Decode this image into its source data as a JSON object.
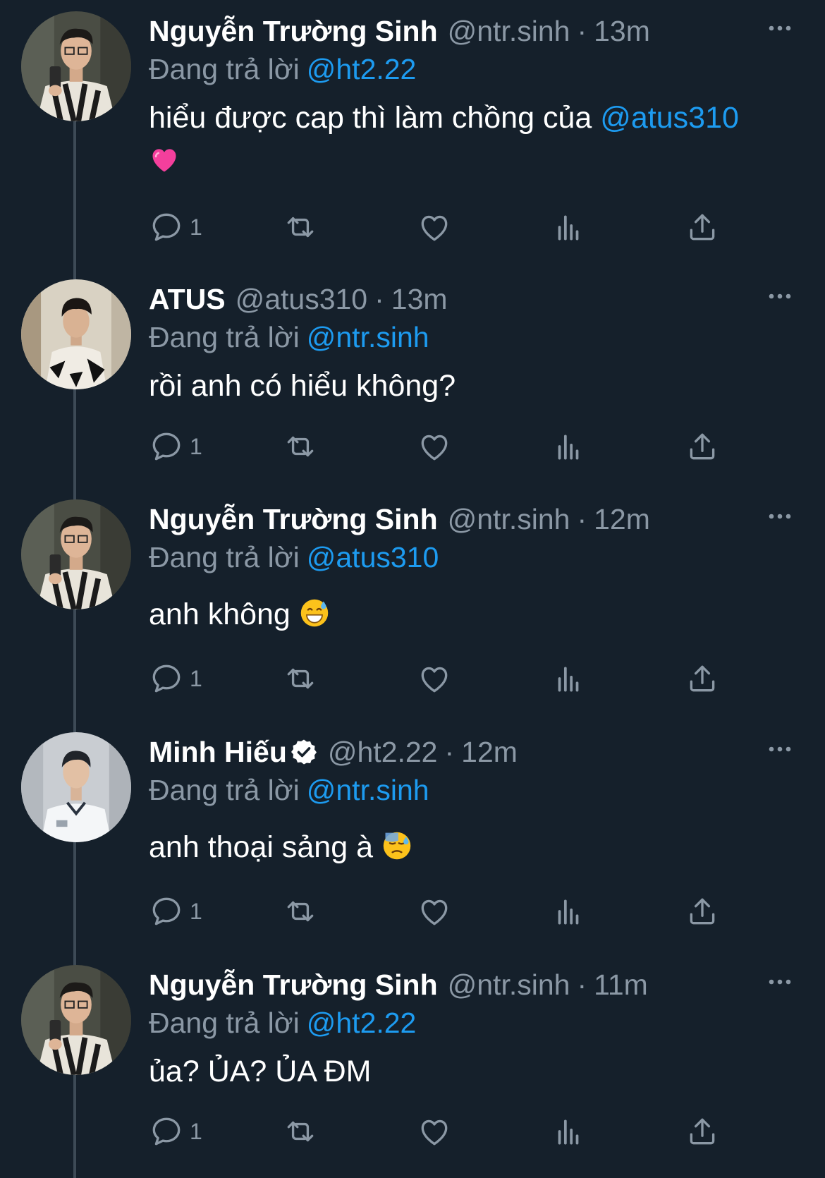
{
  "reply_prefix": "Đang trả lời",
  "colors": {
    "background": "#15202b",
    "accent": "#1d9bf0",
    "muted": "#8b98a5",
    "verified": "#ffffff"
  },
  "icons": [
    "reply-icon",
    "retweet-icon",
    "like-icon",
    "analytics-icon",
    "share-icon",
    "more-icon",
    "verified-badge-icon"
  ],
  "tweets": [
    {
      "name": "Nguyễn Trường Sinh",
      "handle": "@ntr.sinh",
      "separator": "·",
      "time": "13m",
      "reply_to": "@ht2.22",
      "text": "hiểu được cap thì làm chồng của ",
      "mention": "@atus310",
      "emoji": "pink-heart",
      "reply_count": "1"
    },
    {
      "name": "ATUS",
      "handle": "@atus310",
      "separator": "·",
      "time": "13m",
      "reply_to": "@ntr.sinh",
      "text": "rồi anh có hiểu không?",
      "reply_count": "1"
    },
    {
      "name": "Nguyễn Trường Sinh",
      "handle": "@ntr.sinh",
      "separator": "·",
      "time": "12m",
      "reply_to": "@atus310",
      "text": "anh không ",
      "emoji": "grinning-face-with-sweat",
      "reply_count": "1"
    },
    {
      "name": "Minh Hiếu",
      "verified": true,
      "handle": "@ht2.22",
      "separator": "·",
      "time": "12m",
      "reply_to": "@ntr.sinh",
      "text": "anh thoại sảng à ",
      "emoji": "downcast-face-with-sweat",
      "reply_count": "1"
    },
    {
      "name": "Nguyễn Trường Sinh",
      "handle": "@ntr.sinh",
      "separator": "·",
      "time": "11m",
      "reply_to": "@ht2.22",
      "text": "ủa? ỦA? ỦA ĐM",
      "reply_count": "1"
    }
  ]
}
